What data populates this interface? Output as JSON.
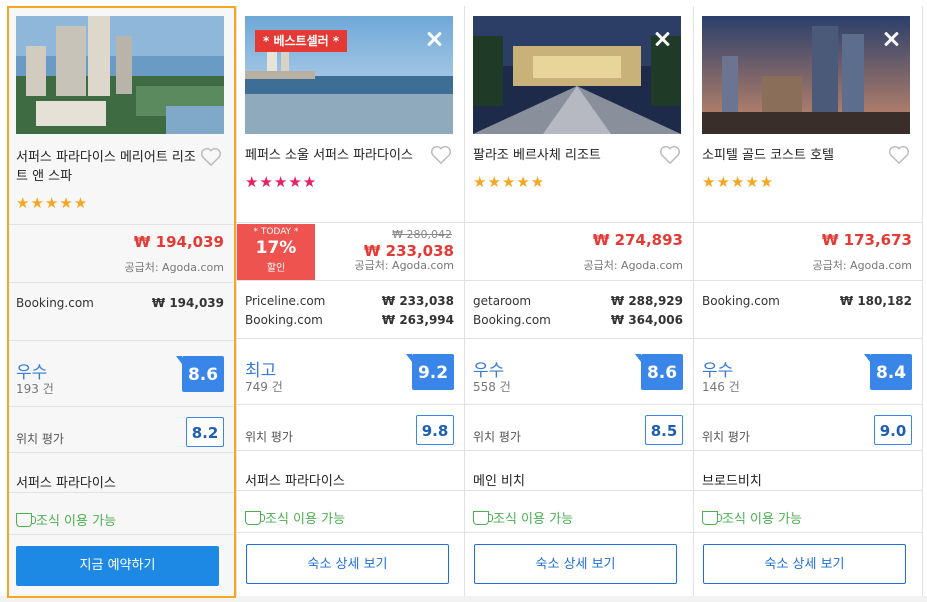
{
  "colors": {
    "accent": "#1e88e5",
    "price": "#e53935",
    "stars": "#f5a623",
    "stars_pink": "#e91e63",
    "breakfast": "#4caf50",
    "selected_border": "#f5a623"
  },
  "hotels": [
    {
      "name": "서퍼스 파라다이스 메리어트 리조트 앤 스파",
      "stars": "★★★★★",
      "price": "₩ 194,039",
      "supplier": "공급처: Agoda.com",
      "offers": [
        {
          "site": "Booking.com",
          "price": "₩ 194,039"
        }
      ],
      "rating_label": "우수",
      "rating_count": "193 건",
      "score": "8.6",
      "location_label": "위치 평가",
      "location_score": "8.2",
      "area": "서퍼스 파라다이스",
      "breakfast": "조식 이용 가능",
      "button": "지금 예약하기",
      "icons": {
        "heart": "heart-icon",
        "cup": "coffee-cup-icon"
      }
    },
    {
      "name": "페퍼스 소울 서퍼스 파라다이스",
      "ribbon": "* 베스트셀러 *",
      "stars": "★★★★★",
      "today_label": "* TODAY *",
      "discount": "17%",
      "discount_word": "할인",
      "old_price": "₩ 280,042",
      "price": "₩ 233,038",
      "supplier": "공급처: Agoda.com",
      "offers": [
        {
          "site": "Priceline.com",
          "price": "₩ 233,038"
        },
        {
          "site": "Booking.com",
          "price": "₩ 263,994"
        }
      ],
      "rating_label": "최고",
      "rating_count": "749 건",
      "score": "9.2",
      "location_label": "위치 평가",
      "location_score": "9.8",
      "area": "서퍼스 파라다이스",
      "breakfast": "조식 이용 가능",
      "button": "숙소 상세 보기"
    },
    {
      "name": "팔라조 베르사체 리조트",
      "stars": "★★★★★",
      "price": "₩ 274,893",
      "supplier": "공급처: Agoda.com",
      "offers": [
        {
          "site": "getaroom",
          "price": "₩ 288,929"
        },
        {
          "site": "Booking.com",
          "price": "₩ 364,006"
        }
      ],
      "rating_label": "우수",
      "rating_count": "558 건",
      "score": "8.6",
      "location_label": "위치 평가",
      "location_score": "8.5",
      "area": "메인 비치",
      "breakfast": "조식 이용 가능",
      "button": "숙소 상세 보기"
    },
    {
      "name": "소피텔 골드 코스트 호텔",
      "stars": "★★★★★",
      "price": "₩ 173,673",
      "supplier": "공급처: Agoda.com",
      "offers": [
        {
          "site": "Booking.com",
          "price": "₩ 180,182"
        }
      ],
      "rating_label": "우수",
      "rating_count": "146 건",
      "score": "8.4",
      "location_label": "위치 평가",
      "location_score": "9.0",
      "area": "브로드비치",
      "breakfast": "조식 이용 가능",
      "button": "숙소 상세 보기"
    }
  ]
}
